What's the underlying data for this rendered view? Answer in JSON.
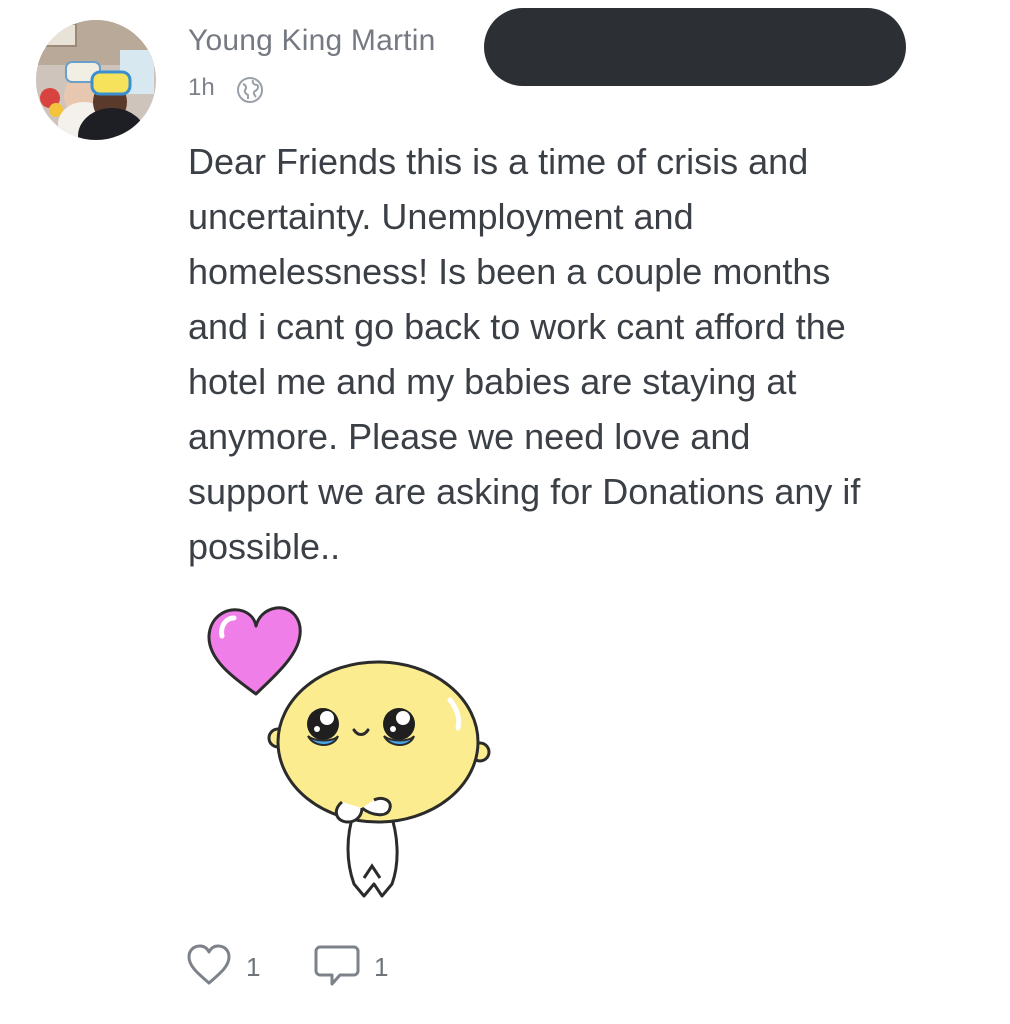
{
  "post": {
    "author": "Young King Martin",
    "timestamp": "1h",
    "visibility_icon": "globe-icon",
    "body_lines": [
      "Dear Friends this is a time of crisis and",
      "uncertainty. Unemployment and",
      "homelessness! Is been a couple months",
      "and i cant go back to work cant afford the",
      "hotel me and my babies are staying at",
      "anymore. Please we need love and",
      "support we are asking for Donations any if",
      "possible.."
    ],
    "sticker": "crying-blob-with-heart-sticker"
  },
  "actions": {
    "like_icon": "heart-outline-icon",
    "like_count": "1",
    "comment_icon": "speech-bubble-icon",
    "comment_count": "1"
  },
  "colors": {
    "text": "#3b3f46",
    "meta": "#757a82",
    "redaction": "#2c3035",
    "heart_sticker": "#f07ee8",
    "blob": "#fbed8f"
  }
}
